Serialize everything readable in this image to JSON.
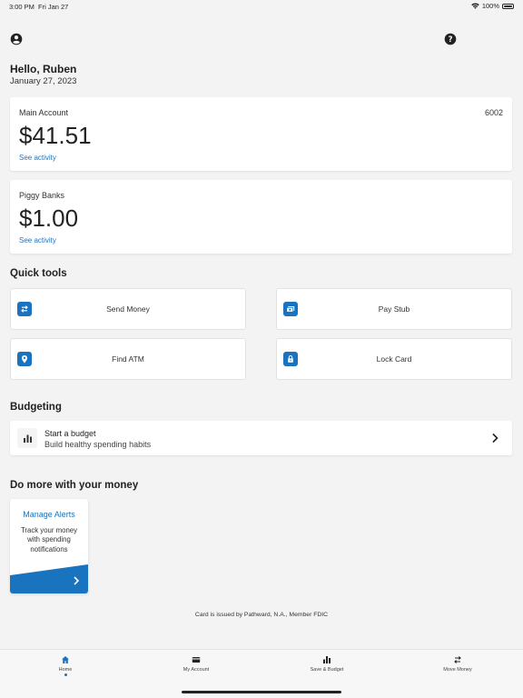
{
  "status_bar": {
    "time": "3:00 PM",
    "date": "Fri Jan 27",
    "battery": "100%"
  },
  "header": {
    "greeting": "Hello, Ruben",
    "date": "January 27, 2023"
  },
  "main_account": {
    "title": "Main Account",
    "number": "6002",
    "balance": "$41.51",
    "link": "See activity"
  },
  "piggy_banks": {
    "title": "Piggy Banks",
    "balance": "$1.00",
    "link": "See activity"
  },
  "quick_tools": {
    "title": "Quick tools",
    "items": [
      {
        "label": "Send Money",
        "icon": "transfer-icon"
      },
      {
        "label": "Pay Stub",
        "icon": "pay-stub-icon"
      },
      {
        "label": "Find ATM",
        "icon": "location-pin-icon"
      },
      {
        "label": "Lock Card",
        "icon": "lock-icon"
      }
    ]
  },
  "budgeting": {
    "title": "Budgeting",
    "card_title": "Start a budget",
    "card_subtitle": "Build healthy spending habits",
    "icon": "bar-chart-icon"
  },
  "do_more": {
    "title": "Do more with your money",
    "card_title": "Manage Alerts",
    "card_description": "Track your money with spending notifications"
  },
  "disclaimer": "Card is issued by Pathward, N.A., Member FDIC",
  "tab_bar": [
    {
      "label": "Home",
      "icon": "home-icon",
      "active": true
    },
    {
      "label": "My Account",
      "icon": "card-icon",
      "active": false
    },
    {
      "label": "Save & Budget",
      "icon": "bar-chart-icon",
      "active": false
    },
    {
      "label": "Move Money",
      "icon": "transfer-icon",
      "active": false
    }
  ],
  "colors": {
    "accent": "#1a73be",
    "link": "#1e73be",
    "background": "#f3f3f3"
  }
}
